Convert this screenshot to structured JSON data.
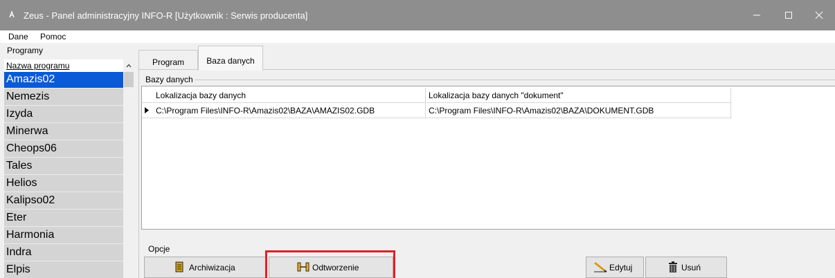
{
  "window": {
    "title": "Zeus - Panel administracyjny INFO-R  [Użytkownik : Serwis producenta]",
    "controls": [
      "minimize",
      "maximize",
      "close"
    ]
  },
  "menu": {
    "items": [
      "Dane",
      "Pomoc"
    ]
  },
  "programs_panel": {
    "caption": "Programy",
    "column_header": "Nazwa programu",
    "items": [
      "Amazis02",
      "Nemezis",
      "Izyda",
      "Minerwa",
      "Cheops06",
      "Tales",
      "Helios",
      "Kalipso02",
      "Eter",
      "Harmonia",
      "Indra",
      "Elpis"
    ],
    "selected": "Amazis02"
  },
  "tabs": [
    {
      "label": "Program",
      "active": false
    },
    {
      "label": "Baza danych",
      "active": true
    }
  ],
  "databases": {
    "group_label": "Bazy danych",
    "columns": [
      "Lokalizacja bazy danych",
      "Lokalizacja bazy danych \"dokument\""
    ],
    "rows": [
      [
        "C:\\Program Files\\INFO-R\\Amazis02\\BAZA\\AMAZIS02.GDB",
        "C:\\Program Files\\INFO-R\\Amazis02\\BAZA\\DOKUMENT.GDB"
      ]
    ]
  },
  "options": {
    "label": "Opcje",
    "buttons": {
      "archive": "Archiwizacja",
      "restore": "Odtworzenie",
      "edit": "Edytuj",
      "delete": "Usuń"
    }
  },
  "colors": {
    "title_bar": "#8e8e8e",
    "selection": "#0a5ad8",
    "highlight": "#e31e24"
  }
}
